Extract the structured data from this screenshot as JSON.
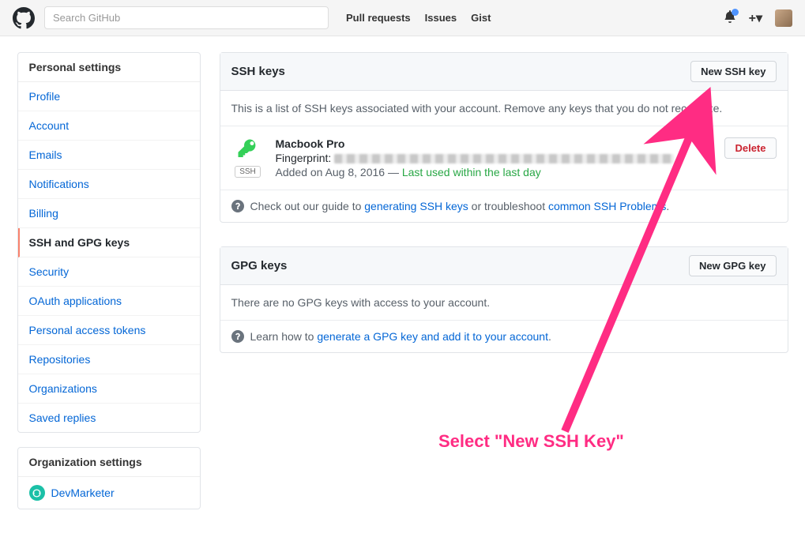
{
  "header": {
    "search_placeholder": "Search GitHub",
    "nav": {
      "pulls": "Pull requests",
      "issues": "Issues",
      "gist": "Gist"
    }
  },
  "sidebar": {
    "personal_header": "Personal settings",
    "items": [
      "Profile",
      "Account",
      "Emails",
      "Notifications",
      "Billing",
      "SSH and GPG keys",
      "Security",
      "OAuth applications",
      "Personal access tokens",
      "Repositories",
      "Organizations",
      "Saved replies"
    ],
    "selected_index": 5,
    "org_header": "Organization settings",
    "org_name": "DevMarketer"
  },
  "ssh": {
    "title": "SSH keys",
    "new_btn": "New SSH key",
    "intro": "This is a list of SSH keys associated with your account. Remove any keys that you do not recognize.",
    "key": {
      "name": "Macbook Pro",
      "fingerprint_label": "Fingerprint:",
      "added_prefix": "Added on ",
      "added_date": "Aug 8, 2016",
      "separator": " — ",
      "last_used": "Last used within the last day",
      "tag": "SSH"
    },
    "delete_btn": "Delete",
    "guide_prefix": "Check out our guide to ",
    "guide_link": "generating SSH keys",
    "guide_mid": " or troubleshoot ",
    "guide_link2": "common SSH Problems",
    "guide_suffix": "."
  },
  "gpg": {
    "title": "GPG keys",
    "new_btn": "New GPG key",
    "empty": "There are no GPG keys with access to your account.",
    "learn_prefix": "Learn how to ",
    "learn_link": "generate a GPG key and add it to your account",
    "learn_suffix": "."
  },
  "annotation": {
    "label": "Select \"New SSH Key\""
  }
}
